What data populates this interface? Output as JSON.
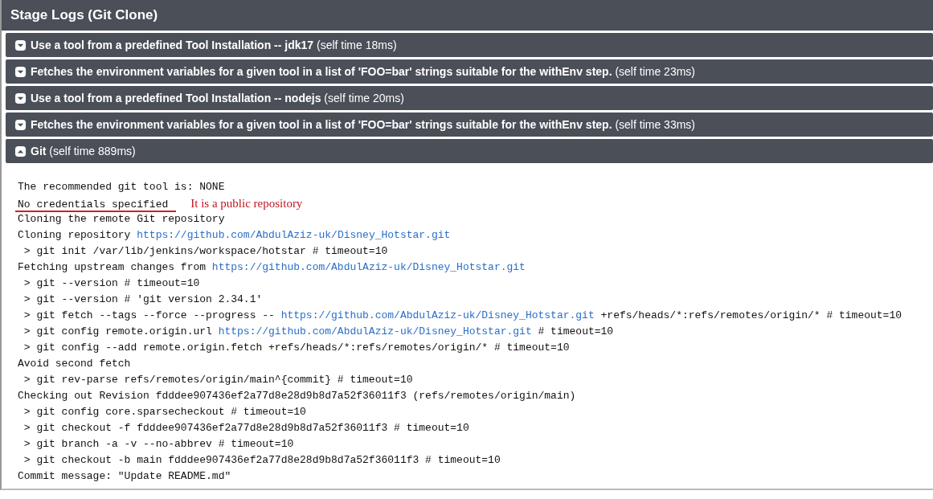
{
  "header": {
    "title": "Stage Logs (Git Clone)"
  },
  "steps": [
    {
      "title": "Use a tool from a predefined Tool Installation -- jdk17",
      "time": "(self time 18ms)",
      "expanded": false
    },
    {
      "title": "Fetches the environment variables for a given tool in a list of 'FOO=bar' strings suitable for the withEnv step.",
      "time": "(self time 23ms)",
      "expanded": false
    },
    {
      "title": "Use a tool from a predefined Tool Installation -- nodejs",
      "time": "(self time 20ms)",
      "expanded": false
    },
    {
      "title": "Fetches the environment variables for a given tool in a list of 'FOO=bar' strings suitable for the withEnv step.",
      "time": "(self time 33ms)",
      "expanded": false
    },
    {
      "title": "Git",
      "time": "(self time 889ms)",
      "expanded": true
    }
  ],
  "log": [
    {
      "parts": [
        {
          "kind": "text",
          "text": "The recommended git tool is: NONE"
        }
      ]
    },
    {
      "parts": [
        {
          "kind": "text",
          "text": "No credentials specified"
        }
      ],
      "underlined": true,
      "note": "It is a public repository"
    },
    {
      "parts": [
        {
          "kind": "text",
          "text": "Cloning the remote Git repository"
        }
      ]
    },
    {
      "parts": [
        {
          "kind": "text",
          "text": "Cloning repository "
        },
        {
          "kind": "link",
          "text": "https://github.com/AbdulAziz-uk/Disney_Hotstar.git"
        }
      ]
    },
    {
      "parts": [
        {
          "kind": "text",
          "text": " > git init /var/lib/jenkins/workspace/hotstar # timeout=10"
        }
      ]
    },
    {
      "parts": [
        {
          "kind": "text",
          "text": "Fetching upstream changes from "
        },
        {
          "kind": "link",
          "text": "https://github.com/AbdulAziz-uk/Disney_Hotstar.git"
        }
      ]
    },
    {
      "parts": [
        {
          "kind": "text",
          "text": " > git --version # timeout=10"
        }
      ]
    },
    {
      "parts": [
        {
          "kind": "text",
          "text": " > git --version # 'git version 2.34.1'"
        }
      ]
    },
    {
      "parts": [
        {
          "kind": "text",
          "text": " > git fetch --tags --force --progress -- "
        },
        {
          "kind": "link",
          "text": "https://github.com/AbdulAziz-uk/Disney_Hotstar.git"
        },
        {
          "kind": "text",
          "text": " +refs/heads/*:refs/remotes/origin/* # timeout=10"
        }
      ]
    },
    {
      "parts": [
        {
          "kind": "text",
          "text": " > git config remote.origin.url "
        },
        {
          "kind": "link",
          "text": "https://github.com/AbdulAziz-uk/Disney_Hotstar.git"
        },
        {
          "kind": "text",
          "text": " # timeout=10"
        }
      ]
    },
    {
      "parts": [
        {
          "kind": "text",
          "text": " > git config --add remote.origin.fetch +refs/heads/*:refs/remotes/origin/* # timeout=10"
        }
      ]
    },
    {
      "parts": [
        {
          "kind": "text",
          "text": "Avoid second fetch"
        }
      ]
    },
    {
      "parts": [
        {
          "kind": "text",
          "text": " > git rev-parse refs/remotes/origin/main^{commit} # timeout=10"
        }
      ]
    },
    {
      "parts": [
        {
          "kind": "text",
          "text": "Checking out Revision fdddee907436ef2a77d8e28d9b8d7a52f36011f3 (refs/remotes/origin/main)"
        }
      ]
    },
    {
      "parts": [
        {
          "kind": "text",
          "text": " > git config core.sparsecheckout # timeout=10"
        }
      ]
    },
    {
      "parts": [
        {
          "kind": "text",
          "text": " > git checkout -f fdddee907436ef2a77d8e28d9b8d7a52f36011f3 # timeout=10"
        }
      ]
    },
    {
      "parts": [
        {
          "kind": "text",
          "text": " > git branch -a -v --no-abbrev # timeout=10"
        }
      ]
    },
    {
      "parts": [
        {
          "kind": "text",
          "text": " > git checkout -b main fdddee907436ef2a77d8e28d9b8d7a52f36011f3 # timeout=10"
        }
      ]
    },
    {
      "parts": [
        {
          "kind": "text",
          "text": "Commit message: \"Update README.md\""
        }
      ]
    }
  ]
}
